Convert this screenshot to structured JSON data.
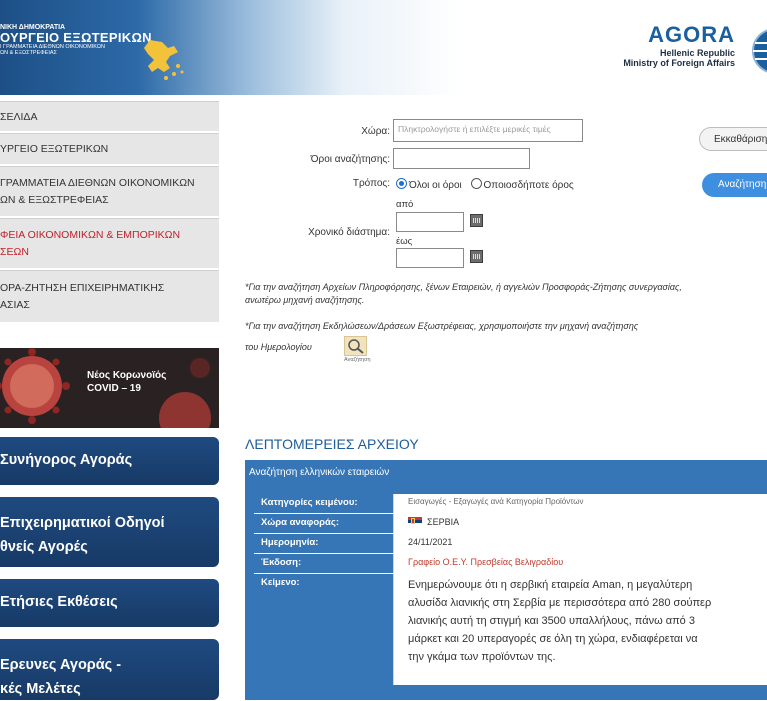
{
  "header": {
    "ministry_line1": "ΝΙΚΗ ΔΗΜΟΚΡΑΤΙΑ",
    "ministry_line2": "ΟΥΡΓΕΙΟ ΕΞΩΤΕΡΙΚΩΝ",
    "ministry_line3": "Ι ΓΡΑΜΜΑΤΕΙΑ ΔΙΕΘΝΩΝ ΟΙΚΟΝΟΜΙΚΩΝ",
    "ministry_line4": "ΩΝ & ΕΞΩΣΤΡΕΦΕΙΑΣ",
    "brand": "AGORA",
    "brand_sub1": "Hellenic Republic",
    "brand_sub2": "Ministry of Foreign Affairs"
  },
  "sidebar": {
    "items": [
      {
        "line1": "ΣΕΛΙΔΑ",
        "line2": ""
      },
      {
        "line1": "ΥΡΓΕΙΟ ΕΞΩΤΕΡΙΚΩΝ",
        "line2": ""
      },
      {
        "line1": "ΓΡΑΜΜΑΤΕΙΑ ΔΙΕΘΝΩΝ ΟΙΚΟΝΟΜΙΚΩΝ",
        "line2": "ΩΝ & ΕΞΩΣΤΡΕΦΕΙΑΣ"
      },
      {
        "line1": "ΦΕΙΑ ΟΙΚΟΝΟΜΙΚΩΝ & ΕΜΠΟΡΙΚΩΝ",
        "line2": "ΣΕΩΝ"
      },
      {
        "line1": "ΟΡΑ-ΖΗΤΗΣΗ ΕΠΙΧΕΙΡΗΜΑΤΙΚΗΣ",
        "line2": "ΑΣΙΑΣ"
      }
    ],
    "covid_line1": "Νέος Κορωνοϊός",
    "covid_line2": "COVID – 19",
    "nav_buttons": [
      {
        "line1": "Συνήγορος Αγοράς",
        "line2": ""
      },
      {
        "line1": "Επιχειρηματικοί Οδηγοί",
        "line2": "θνείς Αγορές"
      },
      {
        "line1": "Ετήσιες Εκθέσεις",
        "line2": ""
      },
      {
        "line1": "Ερευνες Αγοράς -",
        "line2": "κές Μελέτες"
      }
    ]
  },
  "form": {
    "country_label": "Χώρα:",
    "country_placeholder": "Πληκτρολογήστε ή επιλέξτε μερικές τιμές",
    "terms_label": "Όροι αναζήτησης:",
    "mode_label": "Τρόπος:",
    "mode_all": "Όλοι οι όροι",
    "mode_any": "Οποιοσδήποτε όρος",
    "period_label": "Χρονικό διάστημα:",
    "from_label": "από",
    "to_label": "έως",
    "clear_button": "Εκκαθάριση",
    "search_button": "Αναζήτηση"
  },
  "notes": {
    "note1_line1": "*Για την αναζήτηση Αρχείων Πληροφόρησης, ξένων Εταιρειών, ή αγγελιών Προσφοράς-Ζήτησης συνεργασίας,",
    "note1_line2": "ανωτέρω μηχανή αναζήτησης.",
    "note2_line1": "*Για την αναζήτηση Εκδηλώσεων/Δράσεων Εξωστρέφειας, χρησιμοποιήστε την μηχανή αναζήτησης",
    "note2_line2": "του Ημερολογίου",
    "small_search_label": "Αναζήτηση"
  },
  "details": {
    "title": "ΛΕΠΤΟΜΕΡΕΙΕΣ ΑΡΧΕΙΟΥ",
    "panel_header": "Αναζήτηση ελληνικών εταιρειών",
    "rows": {
      "category_key": "Κατηγορίες κειμένου:",
      "category_val": "Εισαγωγές - Εξαγωγές ανά Κατηγορία Προϊόντων",
      "country_key": "Χώρα αναφοράς:",
      "country_val": "ΣΕΡΒΙΑ",
      "date_key": "Ημερομηνία:",
      "date_val": "24/11/2021",
      "issue_key": "Έκδοση:",
      "issue_val": "Γραφείο Ο.Ε.Υ. Πρεσβείας Βελιγραδίου",
      "text_key": "Κείμενο:",
      "text_l1": "Ενημερώνουμε ότι η σερβική εταιρεία Aman, η μεγαλύτερη",
      "text_l2": "αλυσίδα λιανικής στη Σερβία με περισσότερα από 280 σούπερ",
      "text_l3": "λιανικής αυτή τη στιγμή και 3500 υπαλλήλους, πάνω από 3",
      "text_l4": "μάρκετ και 20 υπεραγορές σε όλη τη χώρα, ενδιαφέρεται να",
      "text_l5": "την γκάμα των προϊόντων της."
    }
  }
}
